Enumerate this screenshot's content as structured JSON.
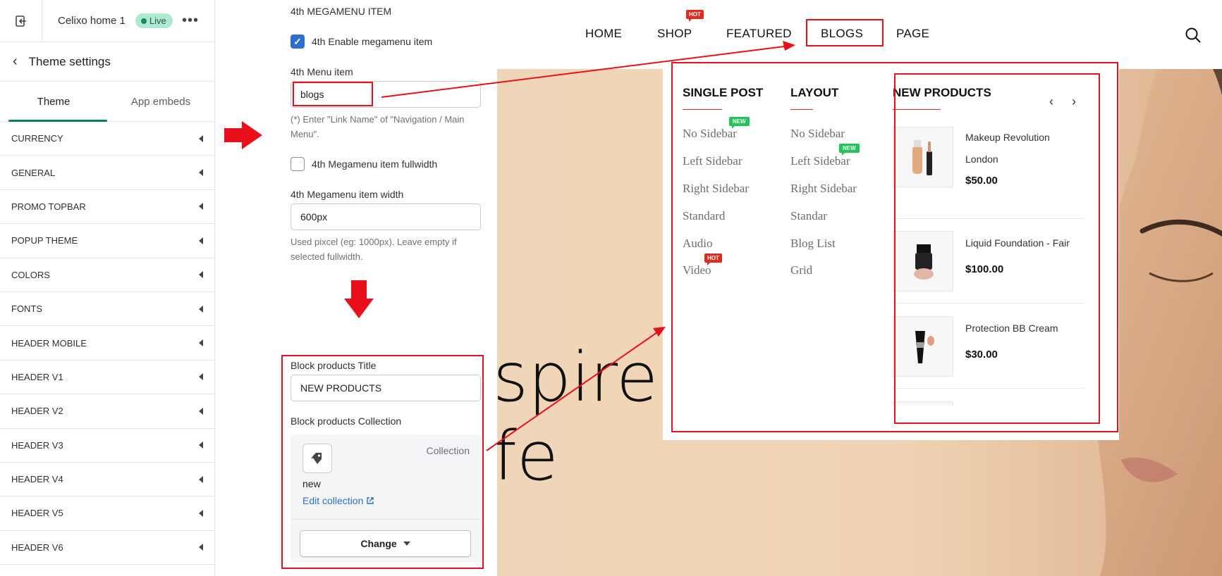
{
  "sidebar": {
    "store_name": "Celixo home 1",
    "live_badge": "Live",
    "more_label": "•••",
    "back_title": "Theme settings",
    "tabs": [
      {
        "label": "Theme",
        "active": true
      },
      {
        "label": "App embeds",
        "active": false
      }
    ],
    "sections": [
      "CURRENCY",
      "GENERAL",
      "PROMO TOPBAR",
      "POPUP THEME",
      "COLORS",
      "FONTS",
      "HEADER MOBILE",
      "HEADER V1",
      "HEADER V2",
      "HEADER V3",
      "HEADER V4",
      "HEADER V5",
      "HEADER V6"
    ]
  },
  "settings": {
    "section_title": "4th MEGAMENU ITEM",
    "enable_label": "4th Enable megamenu item",
    "enable_checked": true,
    "menu_item_label": "4th Menu item",
    "menu_item_value": "blogs",
    "menu_item_help": "(*) Enter \"Link Name\" of \"Navigation / Main Menu\".",
    "fullwidth_label": "4th Megamenu item fullwidth",
    "fullwidth_checked": false,
    "width_label": "4th Megamenu item width",
    "width_value": "600px",
    "width_help": "Used pixcel (eg: 1000px). Leave empty if selected fullwidth.",
    "block_title_label": "Block products Title",
    "block_title_value": "NEW PRODUCTS",
    "block_collection_label": "Block products Collection",
    "collection_type": "Collection",
    "collection_name": "new",
    "edit_collection_label": "Edit collection",
    "change_label": "Change"
  },
  "storefront": {
    "nav": [
      {
        "label": "HOME"
      },
      {
        "label": "SHOP",
        "badge": "HOT"
      },
      {
        "label": "FEATURED"
      },
      {
        "label": "BLOGS"
      },
      {
        "label": "PAGE"
      }
    ],
    "hero_line1": "spired",
    "hero_line2": "fe",
    "megamenu": {
      "col1_title": "SINGLE POST",
      "col1_links": [
        "No Sidebar",
        "Left Sidebar",
        "Right Sidebar",
        "Standard",
        "Audio",
        "Video"
      ],
      "col1_badge_new": "NEW",
      "col1_badge_hot": "HOT",
      "col2_title": "LAYOUT",
      "col2_links": [
        "No Sidebar",
        "Left Sidebar",
        "Right Sidebar",
        "Standar",
        "Blog List",
        "Grid"
      ],
      "col2_badge_new": "NEW",
      "products_title": "NEW PRODUCTS",
      "prev_label": "‹",
      "next_label": "›",
      "products": [
        {
          "name": "Makeup Revolution London",
          "price": "$50.00"
        },
        {
          "name": "Liquid Foundation - Fair",
          "price": "$100.00"
        },
        {
          "name": "Protection BB Cream",
          "price": "$30.00"
        }
      ]
    }
  },
  "colors": {
    "accent_green": "#008060",
    "link_blue": "#2c6ecb",
    "annotation_red": "#e8101a",
    "hot_badge": "#e02b20",
    "new_badge": "#22c35a"
  }
}
